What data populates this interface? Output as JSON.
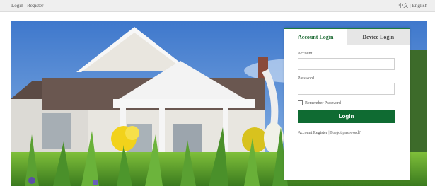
{
  "topbar": {
    "login": "Login",
    "separator": "|",
    "register": "Register",
    "lang_zh": "中文",
    "lang_separator": "|",
    "lang_en": "English"
  },
  "hero": {
    "image": "house-with-lilies-photo"
  },
  "login_panel": {
    "tabs": [
      {
        "label": "Account Login",
        "active": true
      },
      {
        "label": "Device Login",
        "active": false
      }
    ],
    "account_label": "Account",
    "account_value": "",
    "password_label": "Password",
    "password_value": "",
    "remember_label": "Remember Password",
    "remember_checked": false,
    "login_button": "Login",
    "account_register": "Account Register",
    "links_separator": "|",
    "forgot_password": "Forgot password?"
  },
  "colors": {
    "accent_green": "#0f6b32",
    "tab_active_text": "#1e6b34",
    "topbar_bg": "#efefef"
  }
}
